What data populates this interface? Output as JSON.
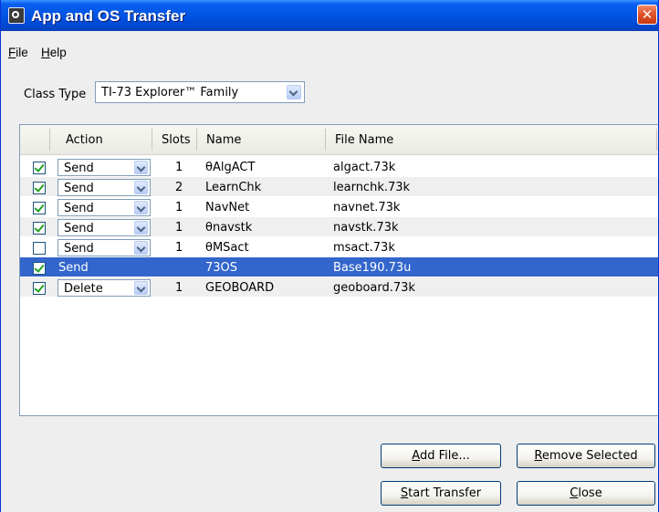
{
  "window": {
    "title": "App and OS Transfer",
    "close_glyph": "✕"
  },
  "menu": [
    {
      "hotkey": "F",
      "rest": "ile"
    },
    {
      "hotkey": "H",
      "rest": "elp"
    }
  ],
  "class_type": {
    "label": "Class Type",
    "value": "TI-73 Explorer™ Family"
  },
  "table": {
    "columns": [
      "Action",
      "Slots",
      "Name",
      "File Name"
    ],
    "rows": [
      {
        "checked": true,
        "action": "Send",
        "slots": "1",
        "name": "θAlgACT",
        "file_name": "algact.73k"
      },
      {
        "checked": true,
        "action": "Send",
        "slots": "2",
        "name": "LearnChk",
        "file_name": "learnchk.73k"
      },
      {
        "checked": true,
        "action": "Send",
        "slots": "1",
        "name": "NavNet",
        "file_name": "navnet.73k"
      },
      {
        "checked": true,
        "action": "Send",
        "slots": "1",
        "name": "θnavstk",
        "file_name": "navstk.73k"
      },
      {
        "checked": false,
        "action": "Send",
        "slots": "1",
        "name": "θMSact",
        "file_name": "msact.73k"
      },
      {
        "checked": true,
        "action": "Send",
        "slots": "",
        "name": "73OS",
        "file_name": "Base190.73u",
        "selected": true
      },
      {
        "checked": true,
        "action": "Delete",
        "slots": "1",
        "name": "GEOBOARD",
        "file_name": "geoboard.73k"
      }
    ]
  },
  "buttons": {
    "add_file": {
      "hotkey": "A",
      "rest": "dd File..."
    },
    "remove_selected": {
      "hotkey": "R",
      "rest": "emove Selected"
    },
    "start_transfer": {
      "hotkey": "S",
      "rest": "tart Transfer"
    },
    "close": {
      "hotkey": "C",
      "rest": "lose"
    }
  },
  "colors": {
    "titlebar": "#0054e3",
    "selection": "#3366cc",
    "check": "#21a121",
    "close_button": "#e2542a"
  },
  "icons": [
    "app-icon",
    "close-icon",
    "dropdown-arrow-icon",
    "checkbox-icon"
  ]
}
